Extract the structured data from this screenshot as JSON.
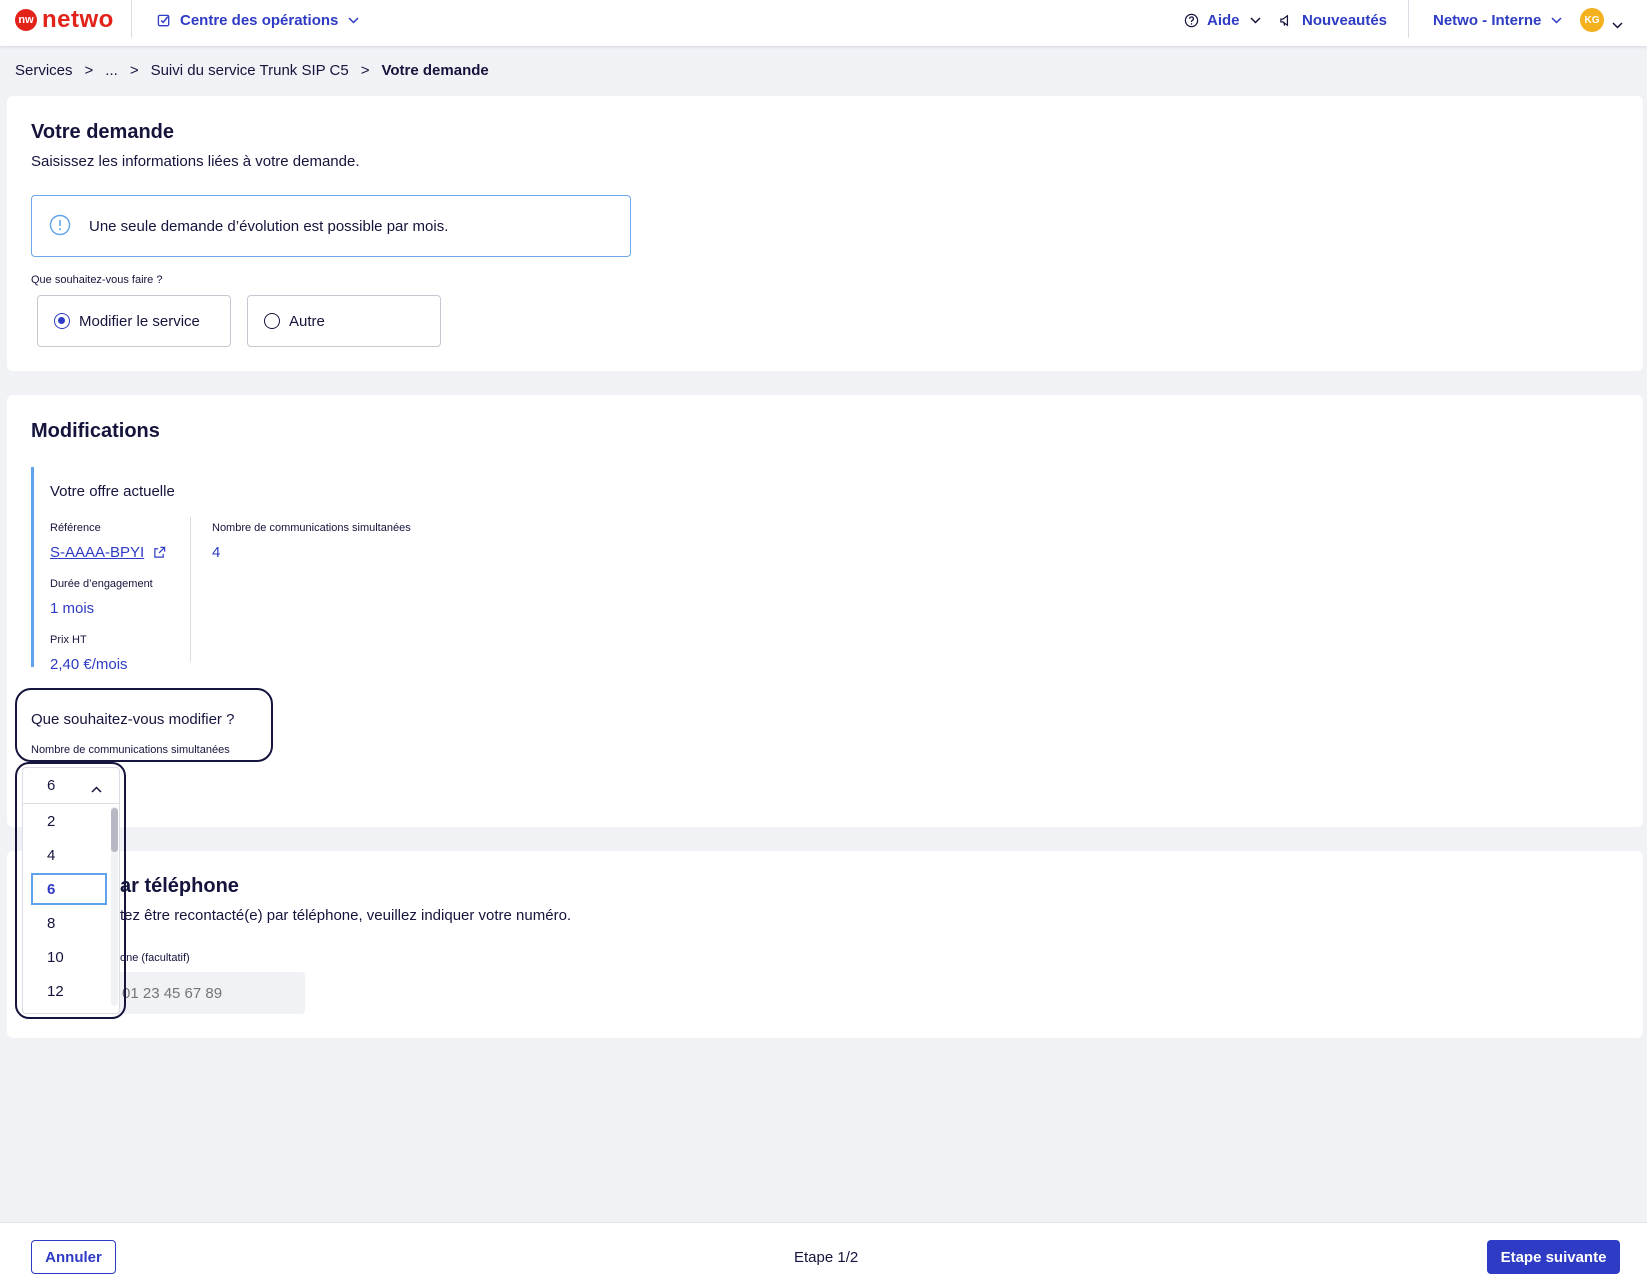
{
  "app": {
    "logo_text": "netwo",
    "logo_mark": "nw",
    "brand_color": "#e2231a",
    "accent_color": "#2e3bc4"
  },
  "nav": {
    "operations_center": "Centre des opérations",
    "help": "Aide",
    "news": "Nouveautés",
    "account": "Netwo - Interne",
    "avatar_initials": "KG"
  },
  "breadcrumb": {
    "items": [
      "Services",
      "...",
      "Suivi du service Trunk SIP C5"
    ],
    "current": "Votre demande"
  },
  "request": {
    "title": "Votre demande",
    "subtitle": "Saisissez les informations liées à votre demande.",
    "info": "Une seule demande d’évolution est possible par mois.",
    "question": "Que souhaitez-vous faire ?",
    "options": [
      {
        "label": "Modifier le service",
        "checked": true
      },
      {
        "label": "Autre",
        "checked": false
      }
    ]
  },
  "modifications": {
    "title": "Modifications",
    "current_offer_title": "Votre offre actuelle",
    "reference_label": "Référence",
    "reference_value": "S-AAAA-BPYI",
    "duration_label": "Durée d’engagement",
    "duration_value": "1 mois",
    "price_label": "Prix HT",
    "price_value": "2,40 €/mois",
    "sim_calls_label": "Nombre de communications simultanées",
    "sim_calls_value": "4",
    "what_to_modify": "Que souhaitez-vous modifier ?",
    "field_label": "Nombre de communications simultanées",
    "selected_value": "6",
    "dropdown_options": [
      "2",
      "4",
      "6",
      "8",
      "10",
      "12"
    ]
  },
  "phone": {
    "title_visible": "ar téléphone",
    "subtitle_visible": "tez être recontacté(e) par téléphone, veuillez indiquer votre numéro.",
    "field_label_visible": "one (facultatif)",
    "placeholder": "01 23 45 67 89"
  },
  "footer": {
    "cancel": "Annuler",
    "step": "Etape 1/2",
    "next": "Etape suivante"
  }
}
